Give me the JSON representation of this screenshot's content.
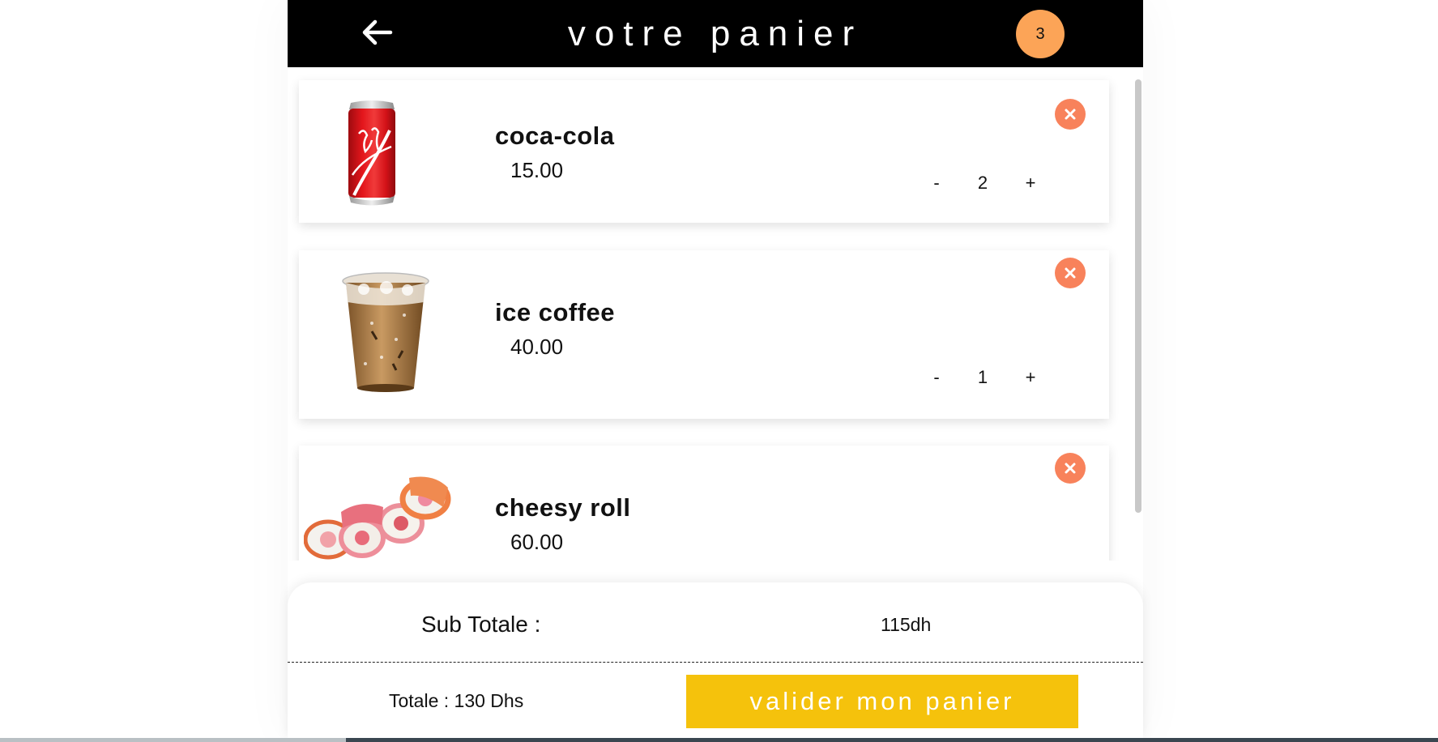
{
  "header": {
    "title": "votre panier",
    "cart_count": "3"
  },
  "items": [
    {
      "name": "coca-cola",
      "price": "15.00",
      "quantity": "2",
      "minus": "-",
      "plus": "+"
    },
    {
      "name": "ice coffee",
      "price": "40.00",
      "quantity": "1",
      "minus": "-",
      "plus": "+"
    },
    {
      "name": "cheesy roll",
      "price": "60.00"
    }
  ],
  "summary": {
    "subtotal_label": "Sub Totale :",
    "subtotal_value": "115dh",
    "total_label": "Totale : 130 Dhs",
    "validate_label": "valider mon panier"
  },
  "colors": {
    "header_bg": "#000000",
    "badge": "#fca457",
    "remove": "#f8825b",
    "validate": "#f5c20c"
  },
  "icons": {
    "back": "arrow-left-icon",
    "remove": "close-icon"
  }
}
